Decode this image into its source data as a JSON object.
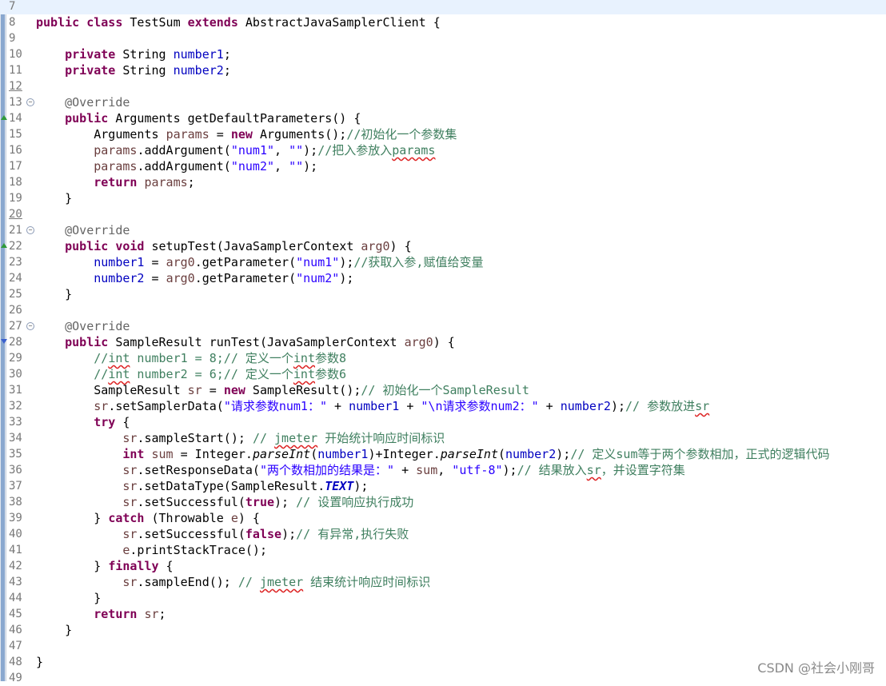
{
  "editor": {
    "lines": [
      {
        "n": "7",
        "html": ""
      },
      {
        "n": "8",
        "html": "<span class=\"kw\">public</span> <span class=\"kw\">class</span> TestSum <span class=\"kw\">extends</span> AbstractJavaSamplerClient {"
      },
      {
        "n": "9",
        "html": ""
      },
      {
        "n": "10",
        "html": "    <span class=\"kw\">private</span> String <span class=\"fld\">number1</span>;"
      },
      {
        "n": "11",
        "html": "    <span class=\"kw\">private</span> String <span class=\"fld\">number2</span>;"
      },
      {
        "n": "12",
        "html": "",
        "underline": true
      },
      {
        "n": "13",
        "html": "    <span class=\"ann\">@Override</span>",
        "fold": true
      },
      {
        "n": "14",
        "html": "    <span class=\"kw\">public</span> Arguments getDefaultParameters() {",
        "mark": "up"
      },
      {
        "n": "15",
        "html": "        Arguments <span class=\"var\">params</span> = <span class=\"kw\">new</span> Arguments();<span class=\"cm\">//初始化一个参数集</span>"
      },
      {
        "n": "16",
        "html": "        <span class=\"var\">params</span>.addArgument(<span class=\"str\">\"num1\"</span>, <span class=\"str\">\"\"</span>);<span class=\"cm\">//把入参放入<span class=\"sq\">params</span></span>"
      },
      {
        "n": "17",
        "html": "        <span class=\"var\">params</span>.addArgument(<span class=\"str\">\"num2\"</span>, <span class=\"str\">\"\"</span>);"
      },
      {
        "n": "18",
        "html": "        <span class=\"kw\">return</span> <span class=\"var\">params</span>;"
      },
      {
        "n": "19",
        "html": "    }"
      },
      {
        "n": "20",
        "html": "",
        "underline": true
      },
      {
        "n": "21",
        "html": "    <span class=\"ann\">@Override</span>",
        "fold": true
      },
      {
        "n": "22",
        "html": "    <span class=\"kw\">public</span> <span class=\"kw\">void</span> setupTest(JavaSamplerContext <span class=\"var\">arg0</span>) {",
        "mark": "up"
      },
      {
        "n": "23",
        "html": "        <span class=\"fld\">number1</span> = <span class=\"var\">arg0</span>.getParameter(<span class=\"str\">\"num1\"</span>);<span class=\"cm\">//获取入参,赋值给变量</span>"
      },
      {
        "n": "24",
        "html": "        <span class=\"fld\">number2</span> = <span class=\"var\">arg0</span>.getParameter(<span class=\"str\">\"num2\"</span>);"
      },
      {
        "n": "25",
        "html": "    }"
      },
      {
        "n": "26",
        "html": ""
      },
      {
        "n": "27",
        "html": "    <span class=\"ann\">@Override</span>",
        "fold": true
      },
      {
        "n": "28",
        "html": "    <span class=\"kw\">public</span> SampleResult runTest(JavaSamplerContext <span class=\"var\">arg0</span>) {",
        "mark": "dn"
      },
      {
        "n": "29",
        "html": "        <span class=\"cm\">//<span class=\"sq\">int</span> number1 = 8;// 定义一个<span class=\"sq\">int</span>参数8</span>"
      },
      {
        "n": "30",
        "html": "        <span class=\"cm\">//<span class=\"sq\">int</span> number2 = 6;// 定义一个<span class=\"sq\">int</span>参数6</span>"
      },
      {
        "n": "31",
        "html": "        SampleResult <span class=\"var\">sr</span> = <span class=\"kw\">new</span> SampleResult();<span class=\"cm\">// 初始化一个SampleResult</span>"
      },
      {
        "n": "32",
        "html": "        <span class=\"var\">sr</span>.setSamplerData(<span class=\"str\">\"请求参数num1：\"</span> + <span class=\"fld\">number1</span> + <span class=\"str\">\"\\n请求参数num2：\"</span> + <span class=\"fld\">number2</span>);<span class=\"cm\">// 参数放进<span class=\"sq\">sr</span></span>"
      },
      {
        "n": "33",
        "html": "        <span class=\"kw\">try</span> {"
      },
      {
        "n": "34",
        "html": "            <span class=\"var\">sr</span>.sampleStart(); <span class=\"cm\">// <span class=\"sq\">jmeter</span> 开始统计响应时间标识</span>"
      },
      {
        "n": "35",
        "html": "            <span class=\"kw\">int</span> <span class=\"var\">sum</span> = Integer.<span class=\"it\">parseInt</span>(<span class=\"fld\">number1</span>)+Integer.<span class=\"it\">parseInt</span>(<span class=\"fld\">number2</span>);<span class=\"cm\">// 定义sum等于两个参数相加，正式的逻辑代码</span>"
      },
      {
        "n": "36",
        "html": "            <span class=\"var\">sr</span>.setResponseData(<span class=\"str\">\"两个数相加的结果是：\"</span> + <span class=\"var\">sum</span>, <span class=\"str\">\"utf-8\"</span>);<span class=\"cm\">// 结果放入<span class=\"sq\">sr</span>，并设置字符集</span>"
      },
      {
        "n": "37",
        "html": "            <span class=\"var\">sr</span>.setDataType(SampleResult.<span class=\"cst\">TEXT</span>);"
      },
      {
        "n": "38",
        "html": "            <span class=\"var\">sr</span>.setSuccessful(<span class=\"kw\">true</span>); <span class=\"cm\">// 设置响应执行成功</span>"
      },
      {
        "n": "39",
        "html": "        } <span class=\"kw\">catch</span> (Throwable <span class=\"var\">e</span>) {"
      },
      {
        "n": "40",
        "html": "            <span class=\"var\">sr</span>.setSuccessful(<span class=\"kw\">false</span>);<span class=\"cm\">// 有异常,执行失败</span>"
      },
      {
        "n": "41",
        "html": "            <span class=\"var\">e</span>.printStackTrace();"
      },
      {
        "n": "42",
        "html": "        } <span class=\"kw\">finally</span> {"
      },
      {
        "n": "43",
        "html": "            <span class=\"var\">sr</span>.sampleEnd(); <span class=\"cm\">// <span class=\"sq\">jmeter</span> 结束统计响应时间标识</span>"
      },
      {
        "n": "44",
        "html": "        }"
      },
      {
        "n": "45",
        "html": "        <span class=\"kw\">return</span> <span class=\"var\">sr</span>;"
      },
      {
        "n": "46",
        "html": "    }"
      },
      {
        "n": "47",
        "html": ""
      },
      {
        "n": "48",
        "html": "}"
      },
      {
        "n": "49",
        "html": ""
      }
    ]
  },
  "watermark": "CSDN @社会小刚哥"
}
